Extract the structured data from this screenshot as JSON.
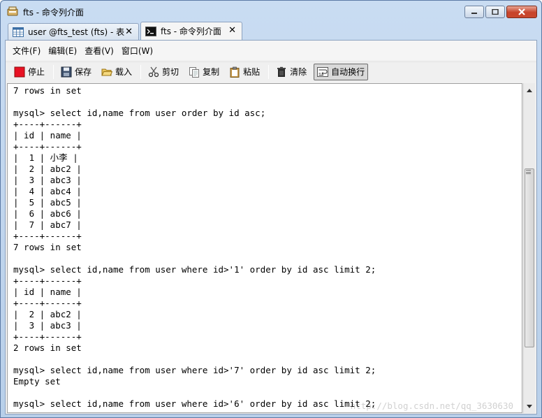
{
  "window": {
    "title": "fts - 命令列介面"
  },
  "colors": {
    "titlebar": "#c9dcf2",
    "close_button": "#c7432b",
    "console_bg": "#ffffff",
    "stop_icon": "#e81123"
  },
  "tabs": [
    {
      "label": "user @fts_test (fts) - 表",
      "icon": "table-icon",
      "active": false,
      "close": "✕"
    },
    {
      "label": "fts - 命令列介面",
      "icon": "terminal-icon",
      "active": true,
      "close": "✕"
    }
  ],
  "menu": [
    {
      "label": "文件(F)"
    },
    {
      "label": "编辑(E)"
    },
    {
      "label": "查看(V)"
    },
    {
      "label": "窗口(W)"
    }
  ],
  "toolbar": {
    "stop": "停止",
    "save": "保存",
    "load": "载入",
    "cut": "剪切",
    "copy": "复制",
    "paste": "粘贴",
    "clear": "清除",
    "wrap": "自动换行"
  },
  "console": {
    "lines": [
      "7 rows in set",
      "",
      "mysql> select id,name from user order by id asc;",
      "+----+------+",
      "| id | name |",
      "+----+------+",
      "|  1 | 小李 |",
      "|  2 | abc2 |",
      "|  3 | abc3 |",
      "|  4 | abc4 |",
      "|  5 | abc5 |",
      "|  6 | abc6 |",
      "|  7 | abc7 |",
      "+----+------+",
      "7 rows in set",
      "",
      "mysql> select id,name from user where id>'1' order by id asc limit 2;",
      "+----+------+",
      "| id | name |",
      "+----+------+",
      "|  2 | abc2 |",
      "|  3 | abc3 |",
      "+----+------+",
      "2 rows in set",
      "",
      "mysql> select id,name from user where id>'7' order by id asc limit 2;",
      "Empty set",
      "",
      "mysql> select id,name from user where id>'6' order by id asc limit 2;"
    ],
    "watermark": "http://blog.csdn.net/qq_3630630"
  }
}
